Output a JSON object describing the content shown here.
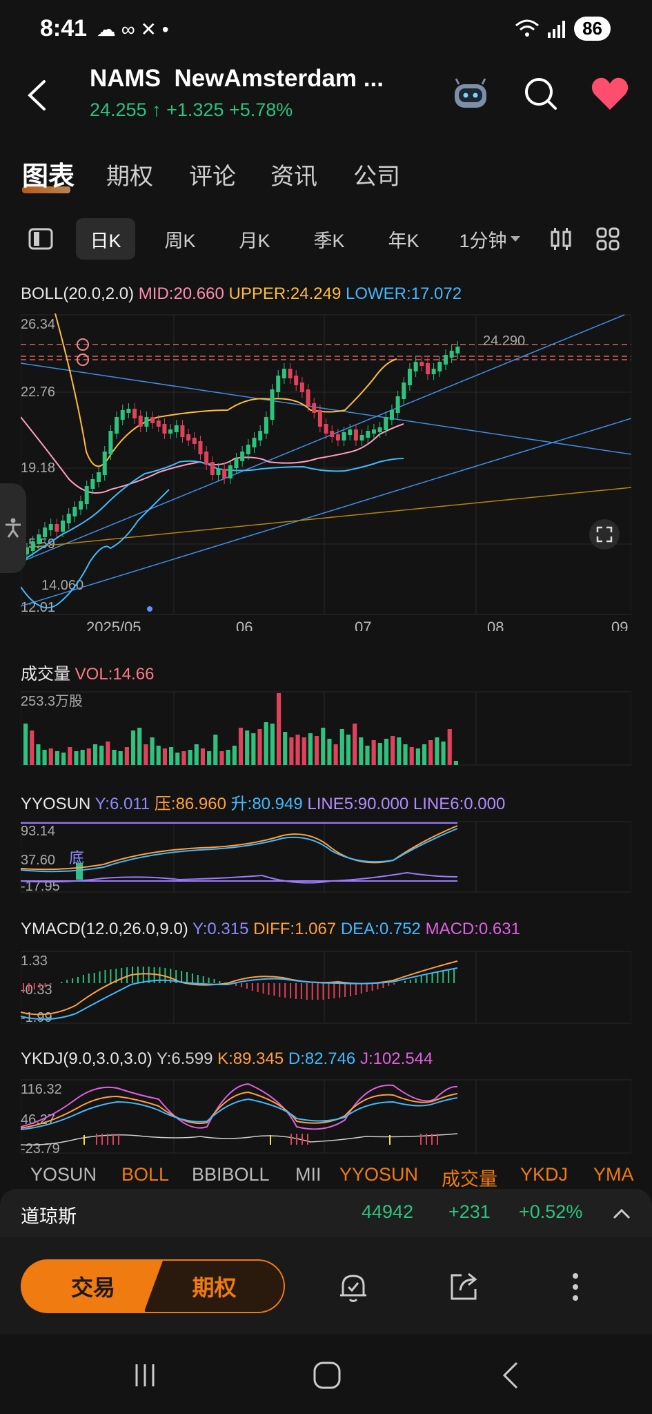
{
  "status_bar": {
    "time": "8:41",
    "icons_left": "☁ ∞ ✕ •",
    "battery": "86",
    "icons": [
      "wifi-icon",
      "signal-icon"
    ]
  },
  "header": {
    "symbol": "NAMS",
    "name": "NewAmsterdam ...",
    "price": "24.255",
    "arrow": "↑",
    "change": "+1.325",
    "change_pct": "+5.78%",
    "colors": {
      "up": "#2ec27e",
      "down": "#e0415b",
      "accent": "#f07b10"
    }
  },
  "tabs": [
    "图表",
    "期权",
    "评论",
    "资讯",
    "公司"
  ],
  "periods": {
    "day": "日K",
    "week": "周K",
    "month": "月K",
    "quarter": "季K",
    "year": "年K",
    "minute": "1分钟"
  },
  "boll": {
    "name": "BOLL(20.0,2.0)",
    "mid": "MID:20.660",
    "upper": "UPPER:24.249",
    "lower": "LOWER:17.072",
    "y_ticks": [
      "26.34",
      "22.76",
      "19.18",
      "15.59",
      "12.01"
    ],
    "price_line_label": "24.290",
    "low_label": "14.060",
    "x_ticks": [
      "2025/05",
      "06",
      "07",
      "08",
      "09"
    ]
  },
  "volume": {
    "name": "成交量",
    "value": "VOL:14.66",
    "scale": "253.3万股"
  },
  "yyosun": {
    "name": "YYOSUN",
    "y": "Y:6.011",
    "ya": "压:86.960",
    "sheng": "升:80.949",
    "line5": "LINE5:90.000",
    "line6": "LINE6:0.000",
    "ticks": [
      "93.14",
      "37.60",
      "-17.95"
    ],
    "di": "底"
  },
  "ymacd": {
    "name": "YMACD(12.0,26.0,9.0)",
    "y": "Y:0.315",
    "diff": "DIFF:1.067",
    "dea": "DEA:0.752",
    "macd": "MACD:0.631",
    "ticks": [
      "1.33",
      "-0.33",
      "-1.99"
    ]
  },
  "ykdj": {
    "name": "YKDJ(9.0,3.0,3.0)",
    "y": "Y:6.599",
    "k": "K:89.345",
    "d": "D:82.746",
    "j": "J:102.544",
    "ticks": [
      "116.32",
      "46.27",
      "-23.79"
    ]
  },
  "indicator_tabs": [
    "YOSUN",
    "BOLL",
    "BBIBOLL",
    "MII",
    "YYOSUN",
    "成交量",
    "YKDJ",
    "YMA"
  ],
  "ticker": {
    "name": "道琼斯",
    "value": "44942",
    "change": "+231",
    "change_pct": "+0.52%"
  },
  "bottom": {
    "trade": "交易",
    "options": "期权"
  }
}
